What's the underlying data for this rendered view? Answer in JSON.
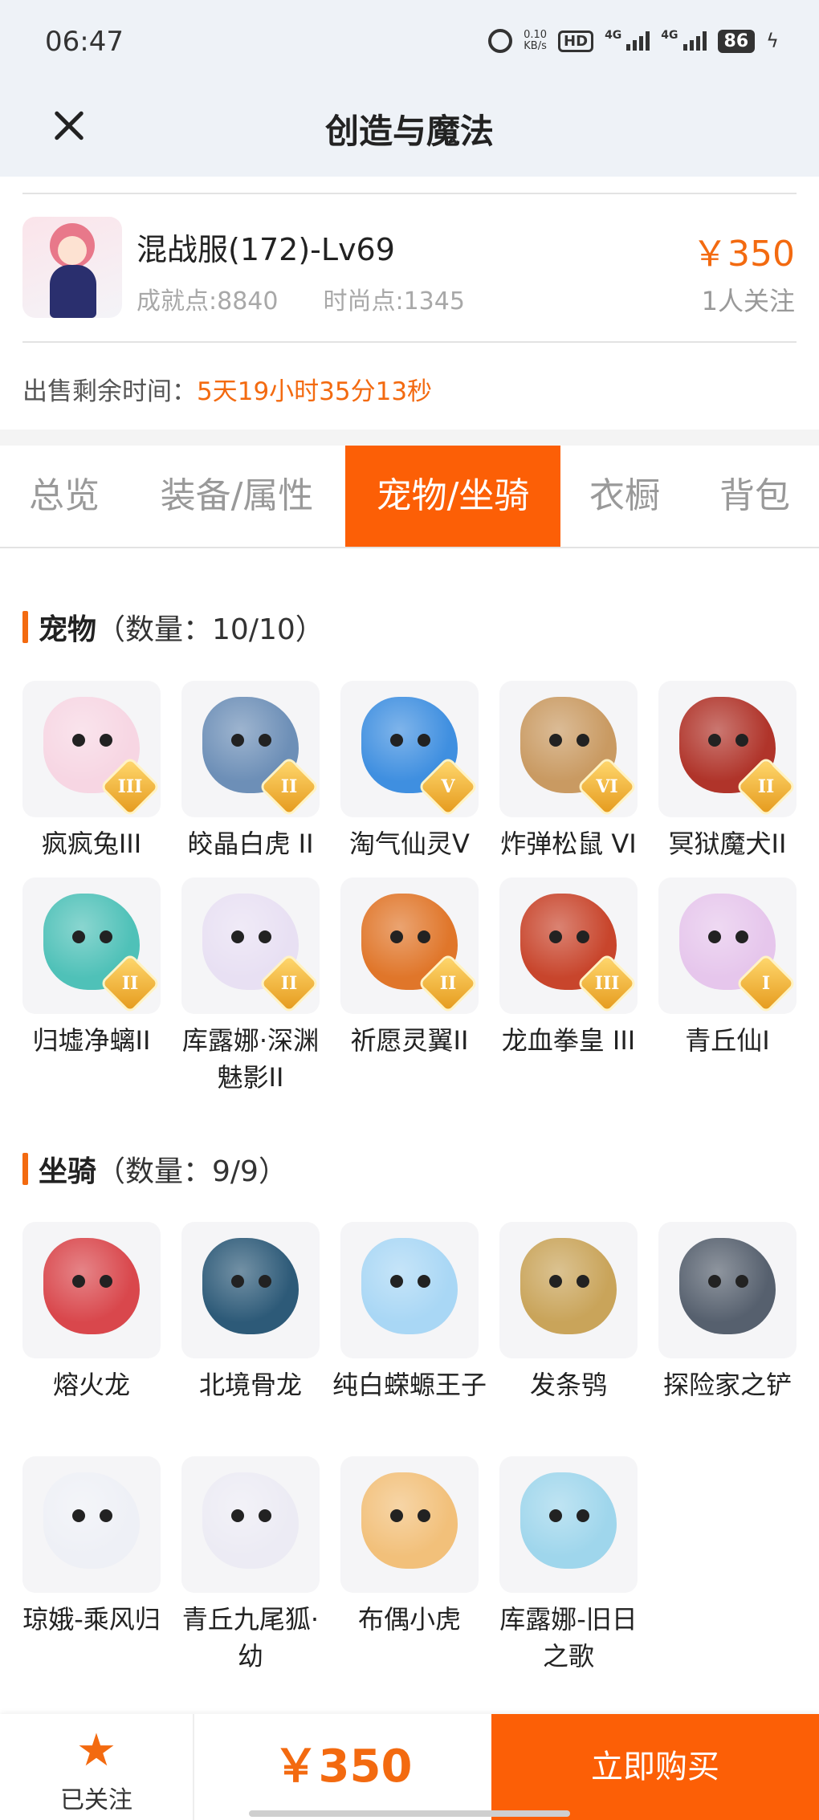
{
  "status_bar": {
    "time": "06:47",
    "net_speed_value": "0.10",
    "net_speed_unit": "KB/s",
    "hd": "HD",
    "sim1": "4G",
    "sim2": "4G",
    "battery": "86"
  },
  "header": {
    "title": "创造与魔法"
  },
  "character": {
    "name": "混战服(172)-Lv69",
    "achievement": "成就点:8840",
    "fashion": "时尚点:1345",
    "price": "￥350",
    "watchers": "1人关注"
  },
  "sale": {
    "label": "出售剩余时间：",
    "value": "5天19小时35分13秒"
  },
  "tabs": [
    {
      "label": "总览",
      "active": false
    },
    {
      "label": "装备/属性",
      "active": false
    },
    {
      "label": "宠物/坐骑",
      "active": true
    },
    {
      "label": "衣橱",
      "active": false
    },
    {
      "label": "背包",
      "active": false
    }
  ],
  "pets": {
    "title": "宠物",
    "count": "（数量：10/10）",
    "items": [
      {
        "label": "疯疯兔III",
        "badge": "III",
        "icon": "rabbit-pet-icon",
        "color": "#f7d6e3"
      },
      {
        "label": "皎晶白虎 II",
        "badge": "II",
        "icon": "tiger-pet-icon",
        "color": "#6d8fb7"
      },
      {
        "label": "淘气仙灵V",
        "badge": "V",
        "icon": "blue-puppy-pet-icon",
        "color": "#3f8fe0"
      },
      {
        "label": "炸弹松鼠 VI",
        "badge": "VI",
        "icon": "squirrel-pet-icon",
        "color": "#c99a62"
      },
      {
        "label": "冥狱魔犬II",
        "badge": "II",
        "icon": "hellhound-pet-icon",
        "color": "#b0342a"
      },
      {
        "label": "归墟净螭II",
        "badge": "II",
        "icon": "jade-dragon-pet-icon",
        "color": "#4fc1b8"
      },
      {
        "label": "库露娜·深渊魅影II",
        "badge": "II",
        "icon": "kuluna-pet-icon",
        "color": "#e8e0f3"
      },
      {
        "label": "祈愿灵翼II",
        "badge": "II",
        "icon": "eagle-pet-icon",
        "color": "#e0762a"
      },
      {
        "label": "龙血拳皇 III",
        "badge": "III",
        "icon": "dragonblood-pet-icon",
        "color": "#c8452c"
      },
      {
        "label": "青丘仙I",
        "badge": "I",
        "icon": "fox-fairy-pet-icon",
        "color": "#e6c6ec"
      }
    ]
  },
  "mounts": {
    "title": "坐骑",
    "count": "（数量：9/9）",
    "items": [
      {
        "label": "熔火龙",
        "icon": "fire-dragon-mount-icon",
        "color": "#d9474c"
      },
      {
        "label": "北境骨龙",
        "icon": "bone-dragon-mount-icon",
        "color": "#2d5a78"
      },
      {
        "label": "纯白蝾螈王子",
        "icon": "salamander-mount-icon",
        "color": "#a9d7f5"
      },
      {
        "label": "发条鸮",
        "icon": "clockwork-owl-mount-icon",
        "color": "#c9a45a"
      },
      {
        "label": "探险家之铲",
        "icon": "shovel-mount-icon",
        "color": "#56606e"
      },
      {
        "label": "琼娥-乘风归",
        "icon": "moon-fairy-mount-icon",
        "color": "#eef0f6"
      },
      {
        "label": "青丘九尾狐·幼",
        "icon": "ninetail-fox-mount-icon",
        "color": "#ecebf4"
      },
      {
        "label": "布偶小虎",
        "icon": "plush-tiger-mount-icon",
        "color": "#f2c07a"
      },
      {
        "label": "库露娜-旧日之歌",
        "icon": "kuluna-song-mount-icon",
        "color": "#9fd6ec"
      }
    ]
  },
  "bottom_bar": {
    "follow_label": "已关注",
    "price": "￥350",
    "buy_label": "立即购买"
  },
  "colors": {
    "accent": "#fc5f06",
    "price": "#f36a10"
  }
}
